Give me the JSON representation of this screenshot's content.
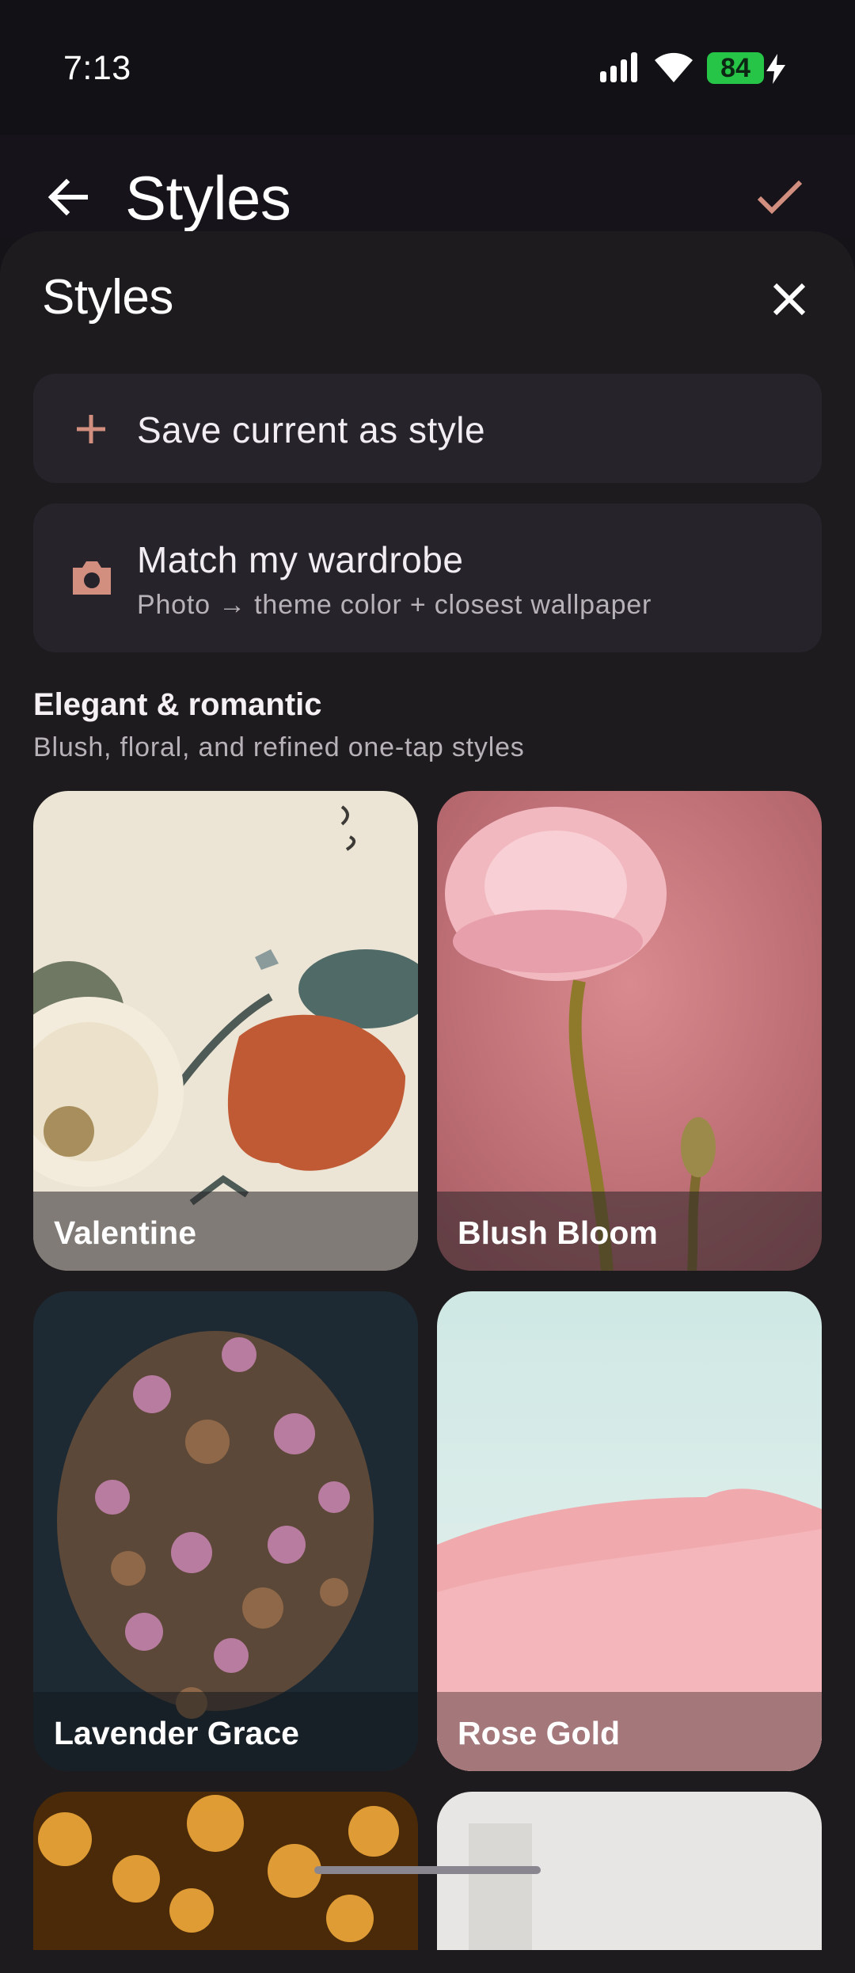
{
  "status_bar": {
    "time": "7:13",
    "battery": "84",
    "icons": [
      "signal-icon",
      "wifi-icon",
      "battery-icon",
      "charging-bolt-icon"
    ]
  },
  "app_bar": {
    "title": "Styles",
    "back_icon": "arrow-left-icon",
    "confirm_icon": "checkmark-icon",
    "accent_color": "#d28f7f"
  },
  "sheet": {
    "title": "Styles",
    "close_icon": "close-x-icon",
    "actions": [
      {
        "label": "Save current as style",
        "icon": "plus-icon"
      },
      {
        "label": "Match my wardrobe",
        "subtitle": "Photo → theme color + closest wallpaper",
        "icon": "camera-icon"
      }
    ],
    "section": {
      "title": "Elegant & romantic",
      "subtitle": "Blush, floral, and refined one-tap styles"
    },
    "styles": [
      {
        "name": "Valentine"
      },
      {
        "name": "Blush Bloom"
      },
      {
        "name": "Lavender Grace"
      },
      {
        "name": "Rose Gold"
      }
    ]
  }
}
